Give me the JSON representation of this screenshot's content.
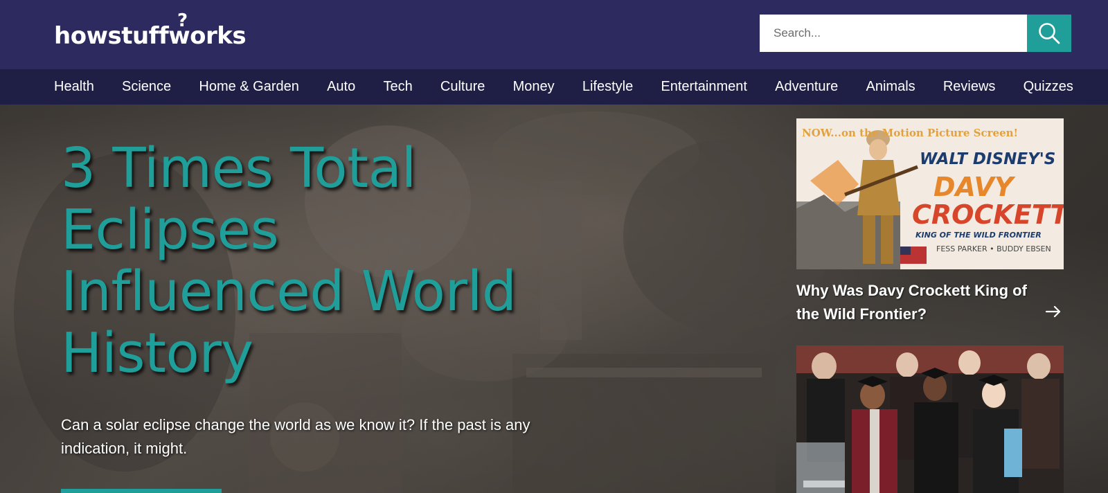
{
  "header": {
    "logo_text": "howstuffworks",
    "search": {
      "placeholder": "Search..."
    },
    "icons": {
      "search": "search-icon"
    }
  },
  "nav": {
    "items": [
      "Health",
      "Science",
      "Home & Garden",
      "Auto",
      "Tech",
      "Culture",
      "Money",
      "Lifestyle",
      "Entertainment",
      "Adventure",
      "Animals",
      "Reviews",
      "Quizzes"
    ]
  },
  "hero": {
    "title": "3 Times Total Eclipses Influenced World History",
    "description": "Can a solar eclipse change the world as we know it? If the past is any indication, it might."
  },
  "side": {
    "cards": [
      {
        "title": "Why Was Davy Crockett King of the Wild Frontier?",
        "arrow_icon": "arrow-right-icon",
        "poster": {
          "top_line": "NOW...on the Motion Picture Screen!",
          "studio": "WALT DISNEY'S",
          "name": "DAVY CROCKETT",
          "subtitle": "KING OF THE WILD FRONTIER",
          "cast": "FESS PARKER • BUDDY EBSEN"
        }
      },
      {
        "title": ""
      }
    ]
  },
  "colors": {
    "header_bg": "#2c2a5e",
    "nav_bg": "#1f1e45",
    "accent": "#1f9e9a",
    "hero_text": "#1f9e9a"
  }
}
